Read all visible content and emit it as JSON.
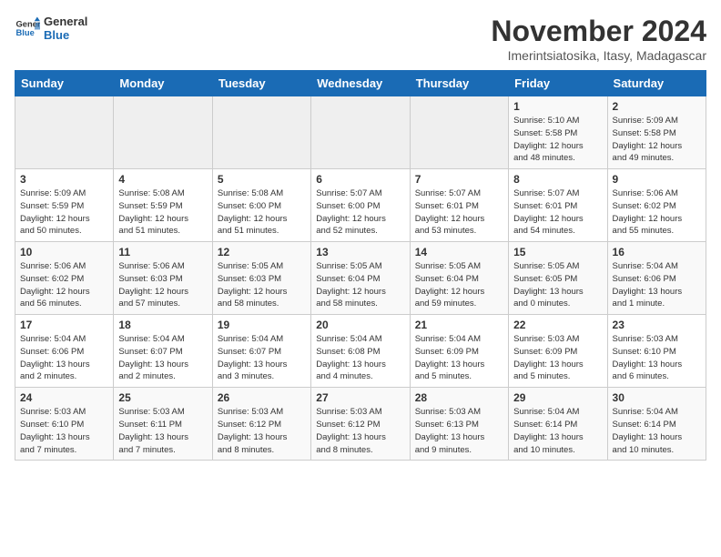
{
  "logo": {
    "line1": "General",
    "line2": "Blue"
  },
  "title": "November 2024",
  "subtitle": "Imerintsiatosika, Itasy, Madagascar",
  "weekdays": [
    "Sunday",
    "Monday",
    "Tuesday",
    "Wednesday",
    "Thursday",
    "Friday",
    "Saturday"
  ],
  "weeks": [
    [
      {
        "day": "",
        "info": ""
      },
      {
        "day": "",
        "info": ""
      },
      {
        "day": "",
        "info": ""
      },
      {
        "day": "",
        "info": ""
      },
      {
        "day": "",
        "info": ""
      },
      {
        "day": "1",
        "info": "Sunrise: 5:10 AM\nSunset: 5:58 PM\nDaylight: 12 hours\nand 48 minutes."
      },
      {
        "day": "2",
        "info": "Sunrise: 5:09 AM\nSunset: 5:58 PM\nDaylight: 12 hours\nand 49 minutes."
      }
    ],
    [
      {
        "day": "3",
        "info": "Sunrise: 5:09 AM\nSunset: 5:59 PM\nDaylight: 12 hours\nand 50 minutes."
      },
      {
        "day": "4",
        "info": "Sunrise: 5:08 AM\nSunset: 5:59 PM\nDaylight: 12 hours\nand 51 minutes."
      },
      {
        "day": "5",
        "info": "Sunrise: 5:08 AM\nSunset: 6:00 PM\nDaylight: 12 hours\nand 51 minutes."
      },
      {
        "day": "6",
        "info": "Sunrise: 5:07 AM\nSunset: 6:00 PM\nDaylight: 12 hours\nand 52 minutes."
      },
      {
        "day": "7",
        "info": "Sunrise: 5:07 AM\nSunset: 6:01 PM\nDaylight: 12 hours\nand 53 minutes."
      },
      {
        "day": "8",
        "info": "Sunrise: 5:07 AM\nSunset: 6:01 PM\nDaylight: 12 hours\nand 54 minutes."
      },
      {
        "day": "9",
        "info": "Sunrise: 5:06 AM\nSunset: 6:02 PM\nDaylight: 12 hours\nand 55 minutes."
      }
    ],
    [
      {
        "day": "10",
        "info": "Sunrise: 5:06 AM\nSunset: 6:02 PM\nDaylight: 12 hours\nand 56 minutes."
      },
      {
        "day": "11",
        "info": "Sunrise: 5:06 AM\nSunset: 6:03 PM\nDaylight: 12 hours\nand 57 minutes."
      },
      {
        "day": "12",
        "info": "Sunrise: 5:05 AM\nSunset: 6:03 PM\nDaylight: 12 hours\nand 58 minutes."
      },
      {
        "day": "13",
        "info": "Sunrise: 5:05 AM\nSunset: 6:04 PM\nDaylight: 12 hours\nand 58 minutes."
      },
      {
        "day": "14",
        "info": "Sunrise: 5:05 AM\nSunset: 6:04 PM\nDaylight: 12 hours\nand 59 minutes."
      },
      {
        "day": "15",
        "info": "Sunrise: 5:05 AM\nSunset: 6:05 PM\nDaylight: 13 hours\nand 0 minutes."
      },
      {
        "day": "16",
        "info": "Sunrise: 5:04 AM\nSunset: 6:06 PM\nDaylight: 13 hours\nand 1 minute."
      }
    ],
    [
      {
        "day": "17",
        "info": "Sunrise: 5:04 AM\nSunset: 6:06 PM\nDaylight: 13 hours\nand 2 minutes."
      },
      {
        "day": "18",
        "info": "Sunrise: 5:04 AM\nSunset: 6:07 PM\nDaylight: 13 hours\nand 2 minutes."
      },
      {
        "day": "19",
        "info": "Sunrise: 5:04 AM\nSunset: 6:07 PM\nDaylight: 13 hours\nand 3 minutes."
      },
      {
        "day": "20",
        "info": "Sunrise: 5:04 AM\nSunset: 6:08 PM\nDaylight: 13 hours\nand 4 minutes."
      },
      {
        "day": "21",
        "info": "Sunrise: 5:04 AM\nSunset: 6:09 PM\nDaylight: 13 hours\nand 5 minutes."
      },
      {
        "day": "22",
        "info": "Sunrise: 5:03 AM\nSunset: 6:09 PM\nDaylight: 13 hours\nand 5 minutes."
      },
      {
        "day": "23",
        "info": "Sunrise: 5:03 AM\nSunset: 6:10 PM\nDaylight: 13 hours\nand 6 minutes."
      }
    ],
    [
      {
        "day": "24",
        "info": "Sunrise: 5:03 AM\nSunset: 6:10 PM\nDaylight: 13 hours\nand 7 minutes."
      },
      {
        "day": "25",
        "info": "Sunrise: 5:03 AM\nSunset: 6:11 PM\nDaylight: 13 hours\nand 7 minutes."
      },
      {
        "day": "26",
        "info": "Sunrise: 5:03 AM\nSunset: 6:12 PM\nDaylight: 13 hours\nand 8 minutes."
      },
      {
        "day": "27",
        "info": "Sunrise: 5:03 AM\nSunset: 6:12 PM\nDaylight: 13 hours\nand 8 minutes."
      },
      {
        "day": "28",
        "info": "Sunrise: 5:03 AM\nSunset: 6:13 PM\nDaylight: 13 hours\nand 9 minutes."
      },
      {
        "day": "29",
        "info": "Sunrise: 5:04 AM\nSunset: 6:14 PM\nDaylight: 13 hours\nand 10 minutes."
      },
      {
        "day": "30",
        "info": "Sunrise: 5:04 AM\nSunset: 6:14 PM\nDaylight: 13 hours\nand 10 minutes."
      }
    ]
  ]
}
